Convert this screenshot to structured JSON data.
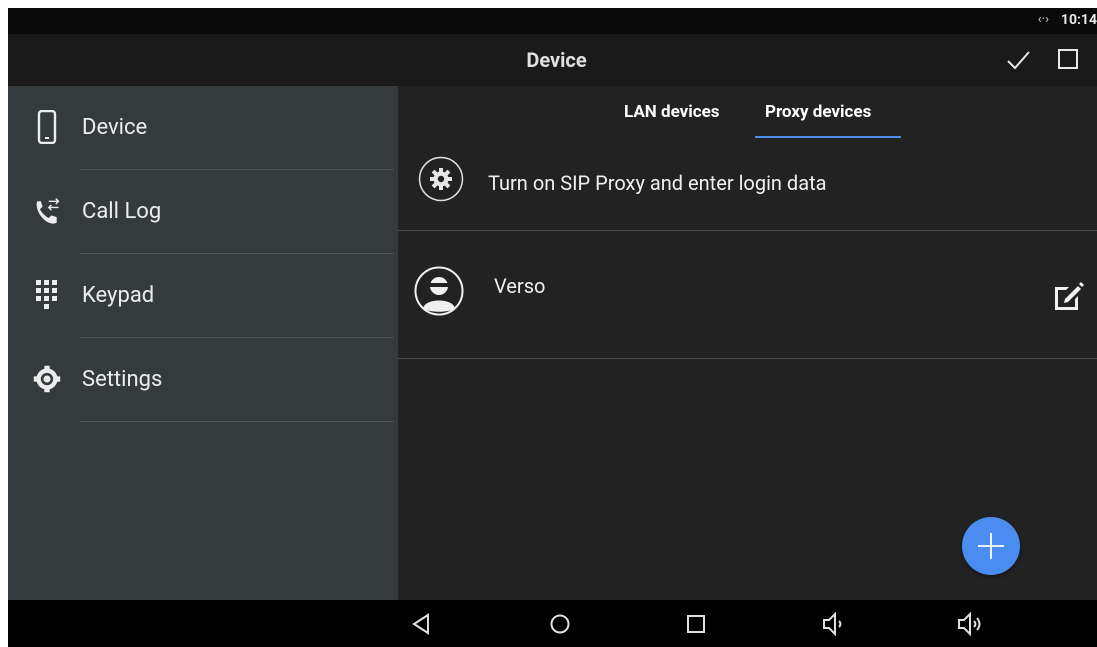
{
  "status_bar": {
    "network_icon": "network-arrows-icon",
    "time": "10:14"
  },
  "app_bar": {
    "title": "Device",
    "confirm_icon": "check-icon",
    "window_icon": "square-icon"
  },
  "sidebar": {
    "items": [
      {
        "label": "Device",
        "icon": "phone-icon"
      },
      {
        "label": "Call Log",
        "icon": "call-log-icon"
      },
      {
        "label": "Keypad",
        "icon": "keypad-icon"
      },
      {
        "label": "Settings",
        "icon": "settings-icon"
      }
    ]
  },
  "tabs": [
    {
      "label": "LAN devices",
      "selected": false
    },
    {
      "label": "Proxy devices",
      "selected": true
    }
  ],
  "hint_row": {
    "text": "Turn on SIP Proxy and enter login data",
    "icon": "gear-icon"
  },
  "devices": [
    {
      "name": "Verso",
      "icon": "avatar-icon",
      "action_icon": "edit-icon"
    }
  ],
  "fab": {
    "icon": "plus-icon"
  },
  "nav_bar": {
    "icons": [
      "back-icon",
      "home-icon",
      "recents-icon",
      "volume-down-icon",
      "volume-up-icon"
    ]
  },
  "colors": {
    "accent": "#4a8cf0",
    "sidebar_bg": "#353b3c",
    "main_bg": "#222222"
  }
}
